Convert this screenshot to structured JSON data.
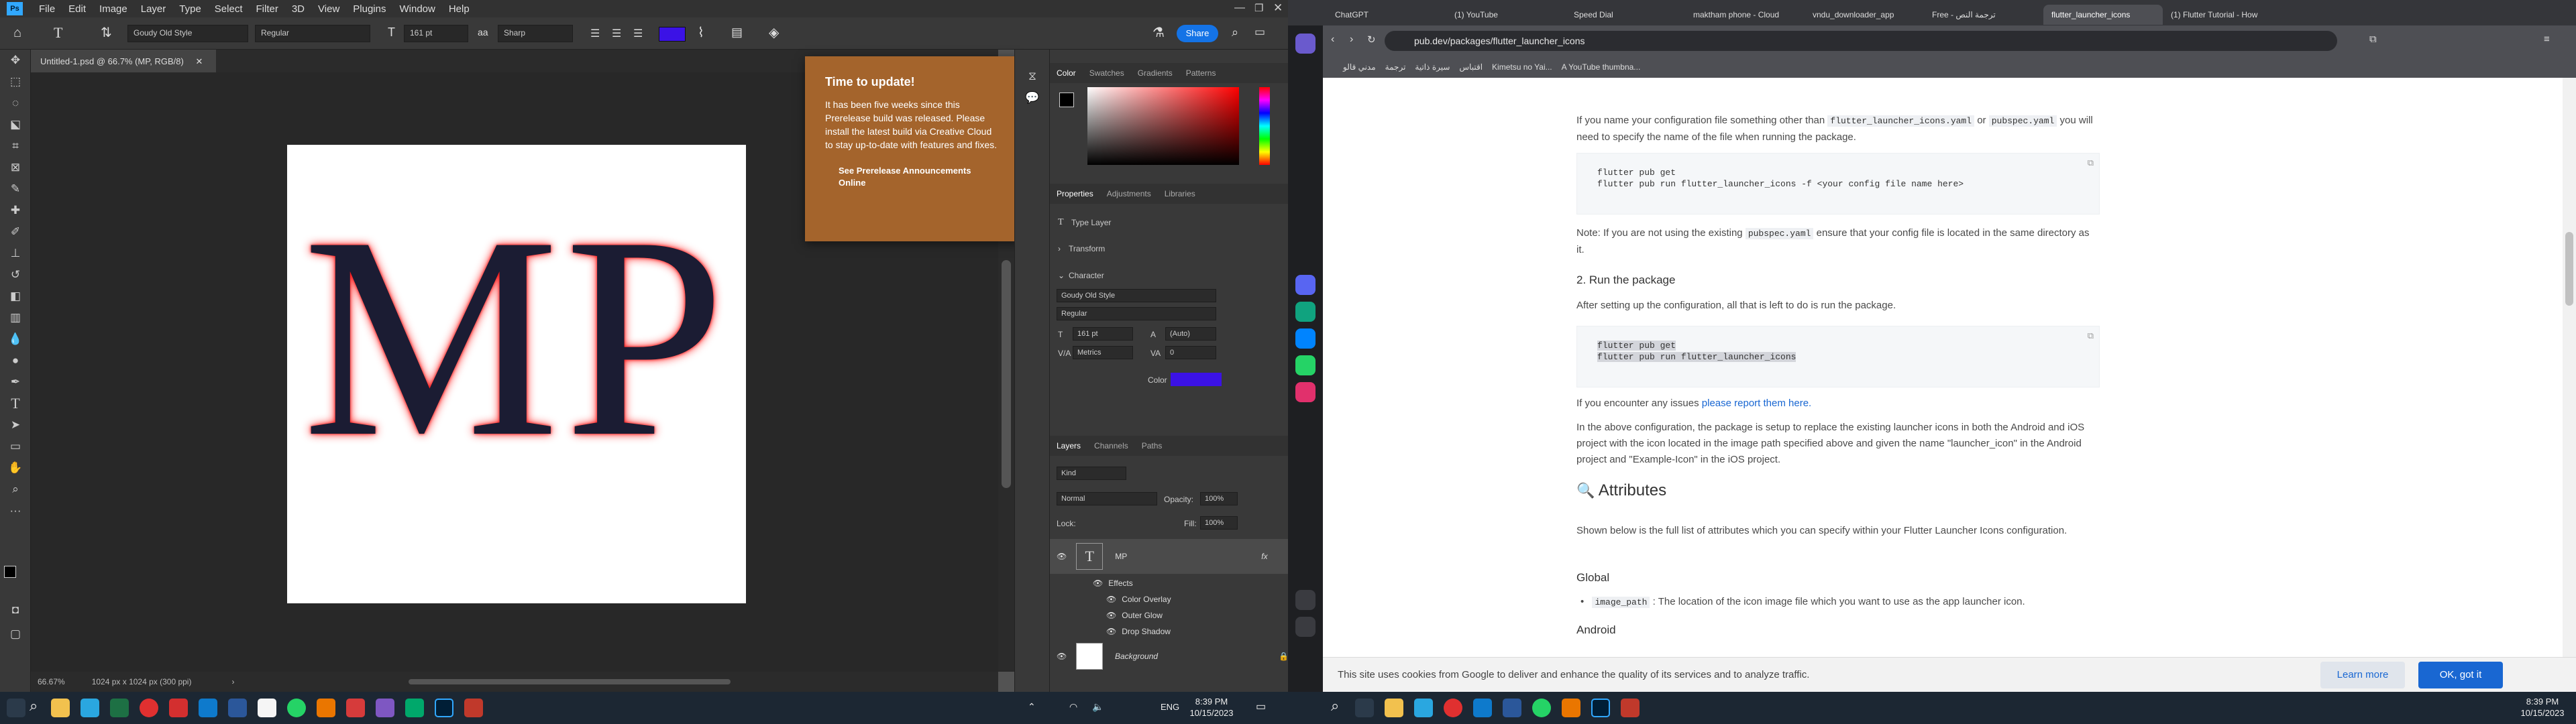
{
  "ps": {
    "menu": [
      "File",
      "Edit",
      "Image",
      "Layer",
      "Type",
      "Select",
      "Filter",
      "3D",
      "View",
      "Plugins",
      "Window",
      "Help"
    ],
    "options": {
      "font": "Goudy Old Style",
      "style": "Regular",
      "size": "161 pt",
      "aa": "Sharp",
      "share": "Share"
    },
    "doc_tab": "Untitled-1.psd @ 66.7% (MP, RGB/8)",
    "canvas_text": "MP",
    "status": {
      "zoom": "66.67%",
      "info": "1024 px x 1024 px (300 ppi)"
    },
    "notice": {
      "title": "Time to update!",
      "body": "It has been five weeks since this Prerelease build was released. Please install the latest build via Creative Cloud to stay up-to-date with features and fixes.",
      "link": "See Prerelease Announcements Online"
    },
    "color_tabs": [
      "Color",
      "Swatches",
      "Gradients",
      "Patterns"
    ],
    "prop_tabs": [
      "Properties",
      "Adjustments",
      "Libraries"
    ],
    "properties": {
      "type_layer": "Type Layer",
      "transform": "Transform",
      "character": "Character",
      "font": "Goudy Old Style",
      "style": "Regular",
      "size": "161 pt",
      "leading": "(Auto)",
      "kerning": "Metrics",
      "tracking": "0",
      "color_label": "Color",
      "text_color": "#3b12e6"
    },
    "layer_tabs": [
      "Layers",
      "Channels",
      "Paths"
    ],
    "layers": {
      "kind": "Kind",
      "blend": "Normal",
      "opacity_label": "Opacity:",
      "opacity": "100%",
      "lock_label": "Lock:",
      "fill_label": "Fill:",
      "fill": "100%",
      "items": [
        {
          "name": "MP",
          "type": "text"
        },
        {
          "name": "Effects",
          "type": "effects"
        },
        {
          "name": "Color Overlay",
          "type": "effect"
        },
        {
          "name": "Outer Glow",
          "type": "effect"
        },
        {
          "name": "Drop Shadow",
          "type": "effect"
        },
        {
          "name": "Background",
          "type": "image"
        }
      ]
    }
  },
  "browser": {
    "tabs": [
      "ChatGPT",
      "(1) YouTube",
      "Speed Dial",
      "maktham phone - Cloud",
      "vndu_downloader_app",
      "Free - ترجمة النص",
      "flutter_launcher_icons",
      "(1) Flutter Tutorial - How"
    ],
    "url": "pub.dev/packages/flutter_launcher_icons",
    "bookmarks": [
      "مدني قالو",
      "ترجمة",
      "سيرة ذاتية",
      "اقتباس",
      "Kimetsu no Yai...",
      "A YouTube thumbna..."
    ],
    "content": {
      "p1_a": "If you name your configuration file something other than",
      "p1_code1": "flutter_launcher_icons.yaml",
      "p1_or": "or",
      "p1_code2": "pubspec.yaml",
      "p1_b": "you will need to specify the name of the file when running the package.",
      "code1_l1": "flutter pub get",
      "code1_l2": "flutter pub run flutter_launcher_icons -f <your config file name here>",
      "note_a": "Note: If you are not using the existing",
      "note_code": "pubspec.yaml",
      "note_b": "ensure that your config file is located in the same directory as it.",
      "step2": "2. Run the package",
      "step2_p": "After setting up the configuration, all that is left to do is run the package.",
      "code2_l1": "flutter pub get",
      "code2_l2": "flutter pub run flutter_launcher_icons",
      "issues_a": "If you encounter any issues",
      "issues_link": "please report them here.",
      "config_p": "In the above configuration, the package is setup to replace the existing launcher icons in both the Android and iOS project with the icon located in the image path specified above and given the name \"launcher_icon\" in the Android project and \"Example-Icon\" in the iOS project.",
      "attr_heading": "Attributes",
      "attr_p": "Shown below is the full list of attributes which you can specify within your Flutter Launcher Icons configuration.",
      "global": "Global",
      "bullet_code": "image_path",
      "bullet_text": ": The location of the icon image file which you want to use as the app launcher icon.",
      "android": "Android"
    },
    "cookie": {
      "text": "This site uses cookies from Google to deliver and enhance the quality of its services and to analyze traffic.",
      "learn": "Learn more",
      "ok": "OK, got it"
    }
  },
  "taskbar": {
    "lang": "ENG",
    "time": "8:39 PM",
    "date": "10/15/2023",
    "time_right": "8:39 PM",
    "date_right": "10/15/2023"
  }
}
